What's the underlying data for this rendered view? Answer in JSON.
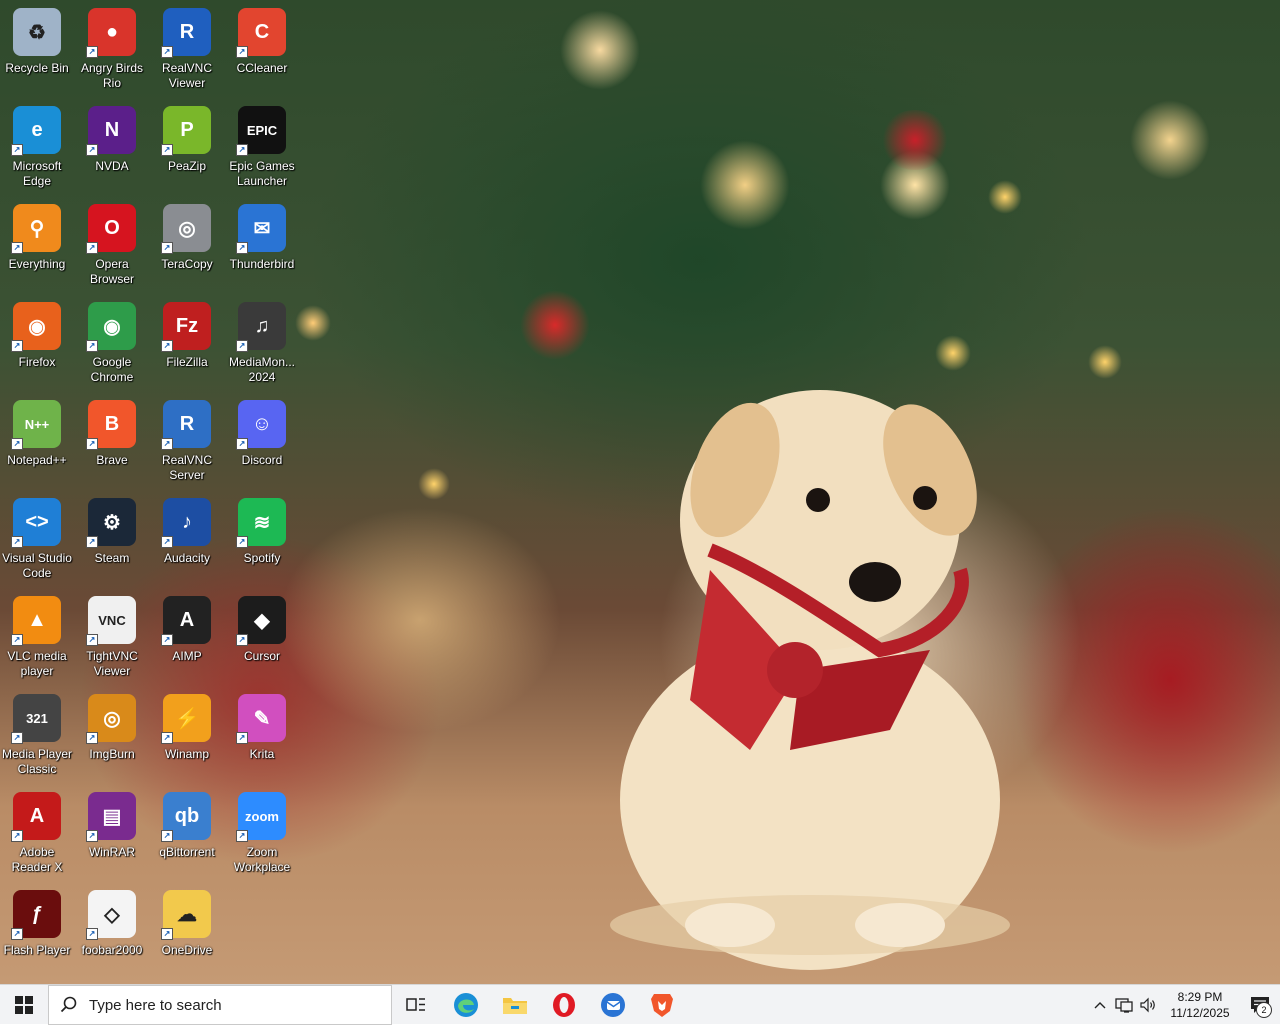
{
  "desktop": {
    "icons": [
      {
        "label": "Recycle Bin",
        "icon": "recycle-bin-icon",
        "color": "#9fb3c8",
        "glyph": "♻"
      },
      {
        "label": "Angry Birds Rio",
        "icon": "angry-birds-icon",
        "color": "#d9342b",
        "glyph": "●"
      },
      {
        "label": "RealVNC Viewer",
        "icon": "realvnc-viewer-icon",
        "color": "#1f5fbf",
        "glyph": "R"
      },
      {
        "label": "CCleaner",
        "icon": "ccleaner-icon",
        "color": "#e2452f",
        "glyph": "C"
      },
      {
        "label": "Microsoft Edge",
        "icon": "edge-icon",
        "color": "#1a8fd6",
        "glyph": "e"
      },
      {
        "label": "NVDA",
        "icon": "nvda-icon",
        "color": "#5b1f8a",
        "glyph": "N"
      },
      {
        "label": "PeaZip",
        "icon": "peazip-icon",
        "color": "#7ab72a",
        "glyph": "P"
      },
      {
        "label": "Epic Games Launcher",
        "icon": "epic-games-icon",
        "color": "#111111",
        "glyph": "EPIC"
      },
      {
        "label": "Everything",
        "icon": "everything-icon",
        "color": "#f08a1c",
        "glyph": "⚲"
      },
      {
        "label": "Opera Browser",
        "icon": "opera-icon",
        "color": "#d6141f",
        "glyph": "O"
      },
      {
        "label": "TeraCopy",
        "icon": "teracopy-icon",
        "color": "#8a8d92",
        "glyph": "◎"
      },
      {
        "label": "Thunderbird",
        "icon": "thunderbird-icon",
        "color": "#2a74d4",
        "glyph": "✉"
      },
      {
        "label": "Firefox",
        "icon": "firefox-icon",
        "color": "#e8611c",
        "glyph": "◉"
      },
      {
        "label": "Google Chrome",
        "icon": "chrome-icon",
        "color": "#2e9c4a",
        "glyph": "◉"
      },
      {
        "label": "FileZilla",
        "icon": "filezilla-icon",
        "color": "#bf1f1f",
        "glyph": "Fz"
      },
      {
        "label": "MediaMon... 2024",
        "icon": "mediamonkey-icon",
        "color": "#3a3a3a",
        "glyph": "♫"
      },
      {
        "label": "Notepad++",
        "icon": "notepadpp-icon",
        "color": "#6fb34a",
        "glyph": "N++"
      },
      {
        "label": "Brave",
        "icon": "brave-icon",
        "color": "#f1562b",
        "glyph": "B"
      },
      {
        "label": "RealVNC Server",
        "icon": "realvnc-server-icon",
        "color": "#2e6fc5",
        "glyph": "R"
      },
      {
        "label": "Discord",
        "icon": "discord-icon",
        "color": "#5865f2",
        "glyph": "☺"
      },
      {
        "label": "Visual Studio Code",
        "icon": "vscode-icon",
        "color": "#1f7fd6",
        "glyph": "<>"
      },
      {
        "label": "Steam",
        "icon": "steam-icon",
        "color": "#1b2838",
        "glyph": "⚙"
      },
      {
        "label": "Audacity",
        "icon": "audacity-icon",
        "color": "#1d4ea3",
        "glyph": "♪"
      },
      {
        "label": "Spotify",
        "icon": "spotify-icon",
        "color": "#1db954",
        "glyph": "≋"
      },
      {
        "label": "VLC media player",
        "icon": "vlc-icon",
        "color": "#f28c11",
        "glyph": "▲"
      },
      {
        "label": "TightVNC Viewer",
        "icon": "tightvnc-icon",
        "color": "#f0f0f0",
        "glyph": "VNC"
      },
      {
        "label": "AIMP",
        "icon": "aimp-icon",
        "color": "#222222",
        "glyph": "A"
      },
      {
        "label": "Cursor",
        "icon": "cursor-icon",
        "color": "#1c1c1c",
        "glyph": "◆"
      },
      {
        "label": "Media Player Classic",
        "icon": "mpc-icon",
        "color": "#444444",
        "glyph": "321"
      },
      {
        "label": "ImgBurn",
        "icon": "imgburn-icon",
        "color": "#d98a1a",
        "glyph": "◎"
      },
      {
        "label": "Winamp",
        "icon": "winamp-icon",
        "color": "#f2a01c",
        "glyph": "⚡"
      },
      {
        "label": "Krita",
        "icon": "krita-icon",
        "color": "#d14fbf",
        "glyph": "✎"
      },
      {
        "label": "Adobe Reader X",
        "icon": "adobe-reader-icon",
        "color": "#c41a1a",
        "glyph": "A"
      },
      {
        "label": "WinRAR",
        "icon": "winrar-icon",
        "color": "#7a2b8f",
        "glyph": "▤"
      },
      {
        "label": "qBittorrent",
        "icon": "qbittorrent-icon",
        "color": "#3a7fcf",
        "glyph": "qb"
      },
      {
        "label": "Zoom Workplace",
        "icon": "zoom-icon",
        "color": "#2d8cff",
        "glyph": "zoom"
      },
      {
        "label": "Flash Player",
        "icon": "flash-player-icon",
        "color": "#6a0d0d",
        "glyph": "ƒ"
      },
      {
        "label": "foobar2000",
        "icon": "foobar2000-icon",
        "color": "#f4f4f4",
        "glyph": "◇"
      },
      {
        "label": "OneDrive",
        "icon": "onedrive-icon",
        "color": "#f2c94c",
        "glyph": "☁"
      }
    ]
  },
  "taskbar": {
    "search_placeholder": "Type here to search",
    "pinned": [
      {
        "name": "task-view",
        "icon": "task-view-icon"
      },
      {
        "name": "edge",
        "icon": "edge-icon"
      },
      {
        "name": "file-explorer",
        "icon": "file-explorer-icon"
      },
      {
        "name": "opera",
        "icon": "opera-icon"
      },
      {
        "name": "thunderbird",
        "icon": "thunderbird-icon"
      },
      {
        "name": "brave",
        "icon": "brave-icon"
      }
    ],
    "clock": {
      "time": "8:29 PM",
      "date": "11/12/2025"
    },
    "notifications_count": "2"
  }
}
